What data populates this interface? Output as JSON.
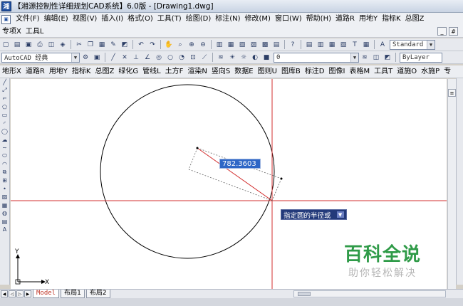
{
  "window": {
    "title": "【湘源控制性详细规划CAD系统】6.0版 - [Drawing1.dwg]",
    "app_icon": "湘"
  },
  "menu": {
    "items": [
      "文件(F)",
      "编辑(E)",
      "视图(V)",
      "插入(I)",
      "格式(O)",
      "工具(T)",
      "绘图(D)",
      "标注(N)",
      "修改(M)",
      "窗口(W)",
      "帮助(H)",
      "道路R",
      "用地Y",
      "指标K",
      "总图Z"
    ]
  },
  "menu2": {
    "items": [
      "专项X",
      "工具L"
    ],
    "controls": [
      "_",
      "#"
    ]
  },
  "toolbar2": {
    "style_combo": "AutoCAD 经典",
    "layer_combo": "0",
    "text_style_combo": "Standard",
    "linetype_combo": "ByLayer"
  },
  "toolbar3": {
    "items": [
      "地形X",
      "道路R",
      "用地Y",
      "指标K",
      "总图Z",
      "绿化G",
      "管线L",
      "土方F",
      "渲染N",
      "竖向S",
      "数据E",
      "图则U",
      "图库B",
      "标注D",
      "图像I",
      "表格M",
      "工具T",
      "道施O",
      "水施P",
      "专"
    ]
  },
  "canvas": {
    "dynamic_input": "782.3603",
    "tooltip": "指定圆的半径或",
    "tooltip_icon": "chevron-down-icon",
    "ucs_y": "Y",
    "ucs_x": "X"
  },
  "watermark": {
    "title": "百科全说",
    "subtitle": "助你轻松解决"
  },
  "layout_tabs": [
    "Model",
    "布局1",
    "布局2"
  ],
  "colors": {
    "crosshair": "#d32f2f",
    "circle": "#000000",
    "watermark_green": "#2f9b48",
    "dynamic_input_bg": "#2e66c6",
    "tooltip_bg": "#233a7a"
  }
}
